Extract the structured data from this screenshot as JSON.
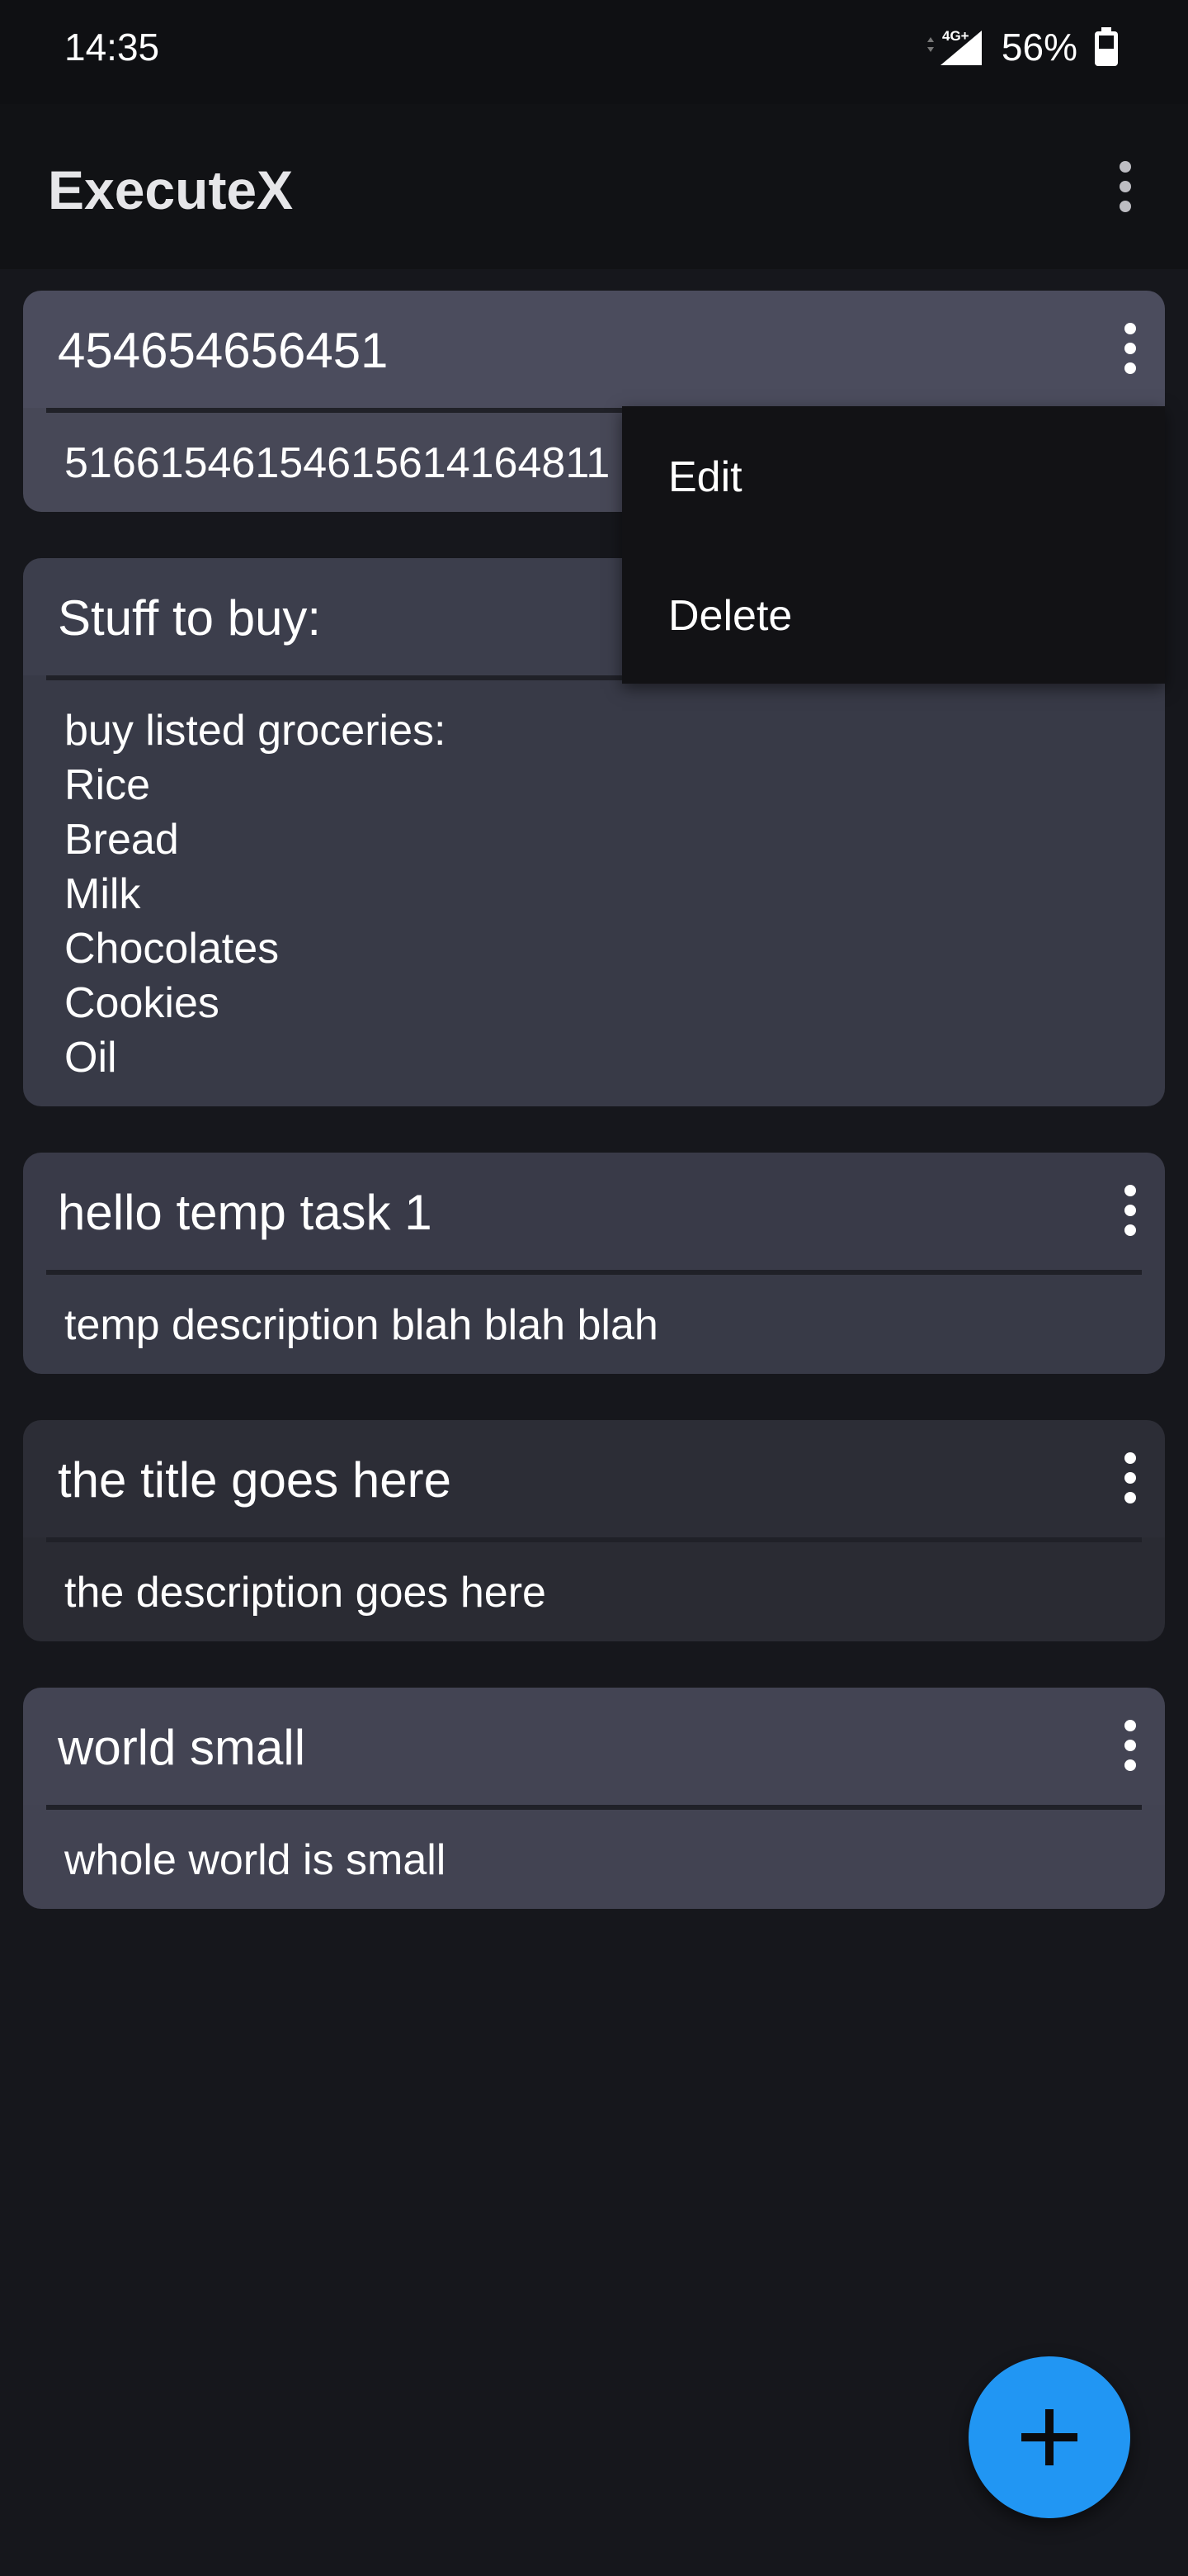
{
  "status_bar": {
    "time": "14:35",
    "network": "4G+",
    "battery": "56%"
  },
  "app_bar": {
    "title": "ExecuteX"
  },
  "tasks": [
    {
      "title": "454654656451",
      "description": "51661546154615614164811"
    },
    {
      "title": "Stuff to buy:",
      "description": "buy listed groceries:\nRice\nBread\nMilk\nChocolates\nCookies\nOil"
    },
    {
      "title": "hello temp task 1",
      "description": "temp description blah blah blah"
    },
    {
      "title": "the title goes here",
      "description": "the description goes here"
    },
    {
      "title": "world small",
      "description": "whole world is small"
    }
  ],
  "popup_menu": {
    "items": [
      "Edit",
      "Delete"
    ]
  },
  "fab": {
    "icon": "plus-icon"
  }
}
